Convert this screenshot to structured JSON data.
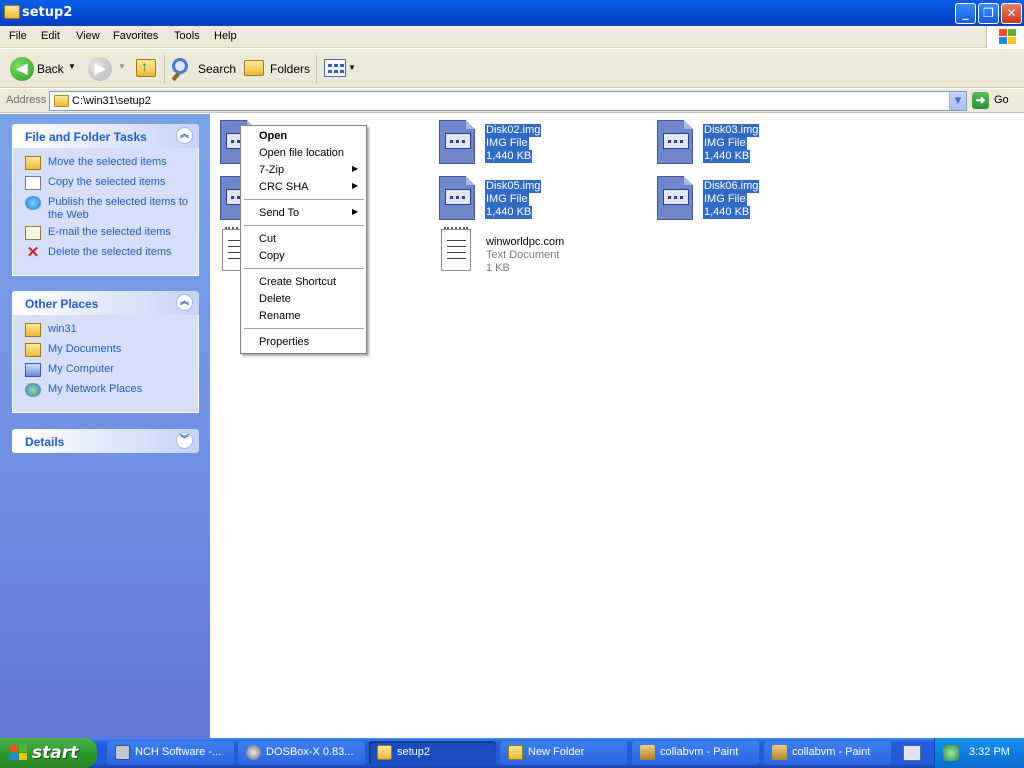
{
  "window": {
    "title": "setup2"
  },
  "menu": [
    "File",
    "Edit",
    "View",
    "Favorites",
    "Tools",
    "Help"
  ],
  "toolbar": {
    "back": "Back",
    "search": "Search",
    "folders": "Folders"
  },
  "address": {
    "label": "Address",
    "path": "C:\\win31\\setup2",
    "go": "Go"
  },
  "file_tasks": {
    "title": "File and Folder Tasks",
    "items": [
      {
        "label": "Move the selected items",
        "icon": "move-icon"
      },
      {
        "label": "Copy the selected items",
        "icon": "copy-icon"
      },
      {
        "label": "Publish the selected items to the Web",
        "icon": "publish-web-icon"
      },
      {
        "label": "E-mail the selected items",
        "icon": "email-icon"
      },
      {
        "label": "Delete the selected items",
        "icon": "delete-icon"
      }
    ]
  },
  "other_places": {
    "title": "Other Places",
    "items": [
      {
        "label": "win31",
        "icon": "folder-icon"
      },
      {
        "label": "My Documents",
        "icon": "my-documents-icon"
      },
      {
        "label": "My Computer",
        "icon": "my-computer-icon"
      },
      {
        "label": "My Network Places",
        "icon": "network-places-icon"
      }
    ]
  },
  "details": {
    "title": "Details"
  },
  "files": [
    {
      "name": "Disk02.img",
      "type": "IMG File",
      "size": "1,440 KB",
      "selected": true
    },
    {
      "name": "Disk03.img",
      "type": "IMG File",
      "size": "1,440 KB",
      "selected": true
    },
    {
      "name": "Disk05.img",
      "type": "IMG File",
      "size": "1,440 KB",
      "selected": true
    },
    {
      "name": "Disk06.img",
      "type": "IMG File",
      "size": "1,440 KB",
      "selected": true
    },
    {
      "name": "winworldpc.com",
      "type": "Text Document",
      "size": "1 KB",
      "selected": false
    }
  ],
  "context_menu": {
    "open": "Open",
    "open_location": "Open file location",
    "zip": "7-Zip",
    "crc": "CRC SHA",
    "send_to": "Send To",
    "cut": "Cut",
    "copy": "Copy",
    "create_shortcut": "Create Shortcut",
    "delete": "Delete",
    "rename": "Rename",
    "properties": "Properties"
  },
  "taskbar": {
    "start": "start",
    "tasks": [
      {
        "label": "NCH Software -...",
        "icon": "nch-icon"
      },
      {
        "label": "DOSBox-X 0.83...",
        "icon": "dosbox-icon"
      },
      {
        "label": "setup2",
        "icon": "folder-icon",
        "active": true
      },
      {
        "label": "New Folder",
        "icon": "folder-icon"
      },
      {
        "label": "collabvm - Paint",
        "icon": "paint-icon"
      },
      {
        "label": "collabvm - Paint",
        "icon": "paint-icon"
      }
    ],
    "clock": "3:32 PM"
  },
  "colors": {
    "selection": "#316ac5",
    "task_link": "#215dc6",
    "taskbar": "#245edc",
    "start": "#2e9a2e"
  }
}
